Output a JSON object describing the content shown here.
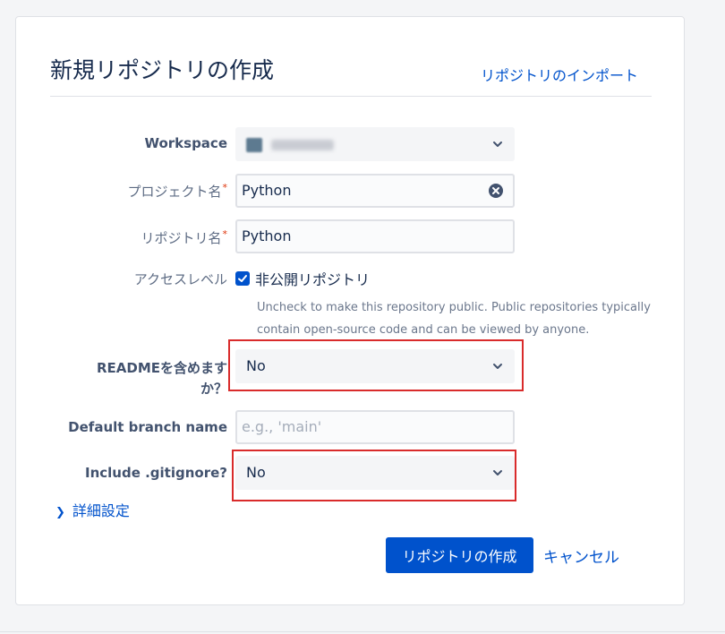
{
  "header": {
    "title": "新規リポジトリの作成",
    "import_link": "リポジトリのインポート"
  },
  "form": {
    "workspace": {
      "label": "Workspace",
      "value_icon": "workspace-avatar",
      "value_blurred": true
    },
    "project": {
      "label": "プロジェクト名",
      "required_mark": "*",
      "value": "Python"
    },
    "repository": {
      "label": "リポジトリ名",
      "required_mark": "*",
      "value": "Python"
    },
    "access": {
      "label": "アクセスレベル",
      "checkbox_label": "非公開リポジトリ",
      "checked": true,
      "help_text": "Uncheck to make this repository public. Public repositories typically contain open-source code and can be viewed by anyone."
    },
    "readme": {
      "label": "READMEを含めます か？",
      "value": "No"
    },
    "default_branch": {
      "label": "Default branch name",
      "placeholder": "e.g., 'main'"
    },
    "gitignore": {
      "label": "Include .gitignore?",
      "value": "No"
    },
    "advanced": {
      "label": "詳細設定"
    }
  },
  "actions": {
    "create_label": "リポジトリの作成",
    "cancel_label": "キャンセル"
  },
  "colors": {
    "primary": "#0052cc",
    "highlight": "#d92b2b",
    "required": "#de350b"
  }
}
